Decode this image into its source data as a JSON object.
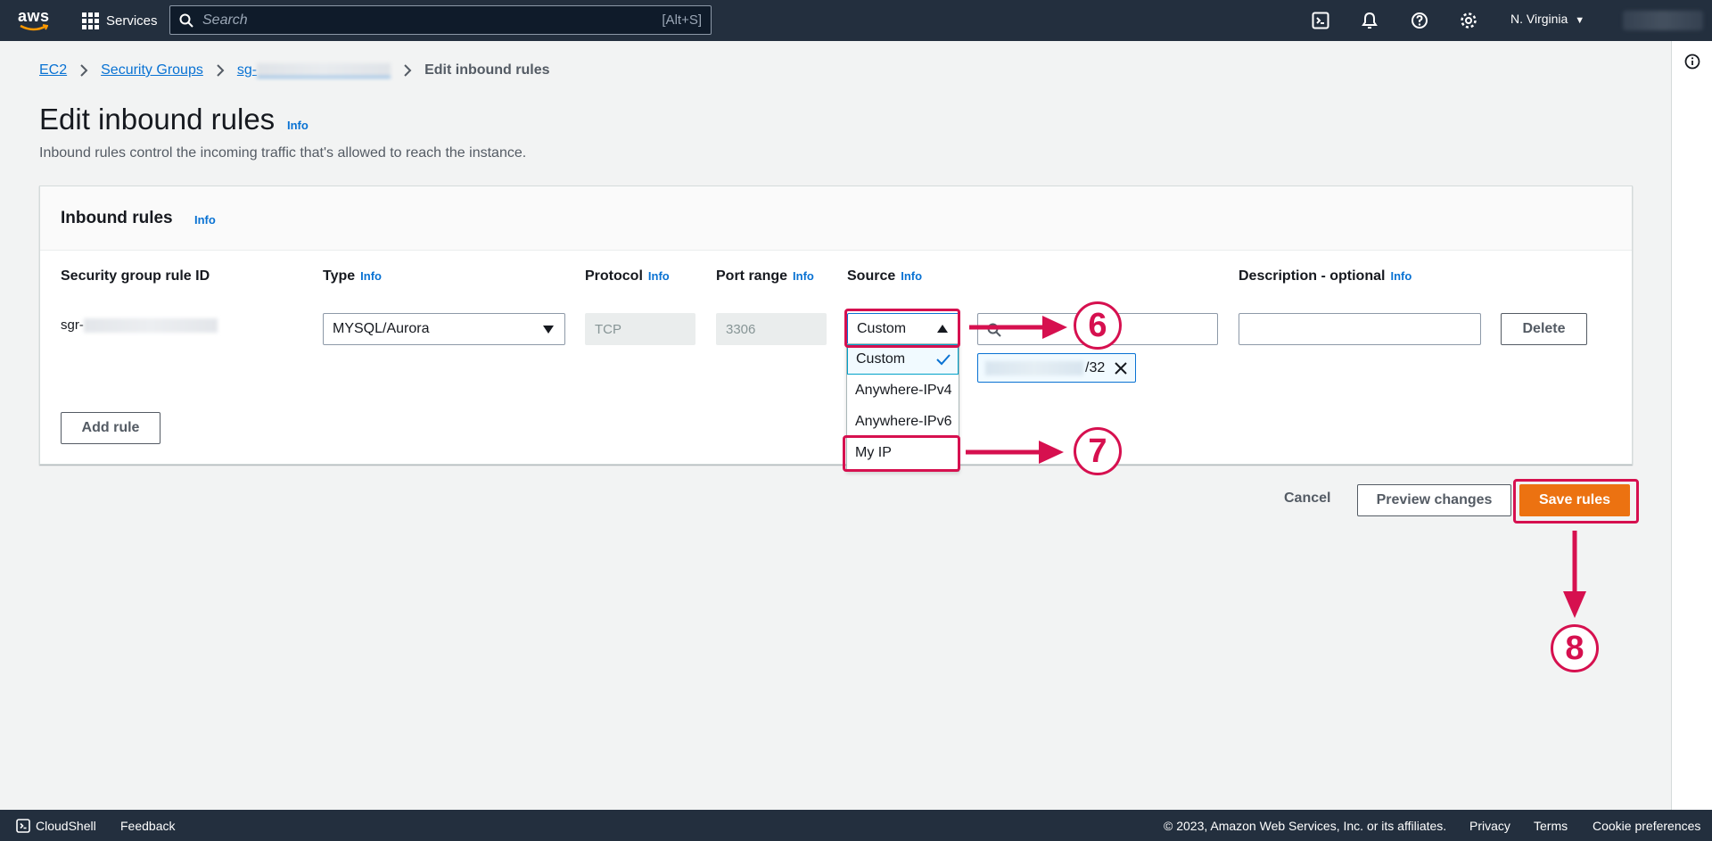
{
  "topnav": {
    "logo_text": "aws",
    "services_label": "Services",
    "search_placeholder": "Search",
    "search_shortcut": "[Alt+S]",
    "region_label": "N. Virginia"
  },
  "breadcrumb": {
    "items": [
      "EC2",
      "Security Groups",
      "sg-"
    ],
    "current": "Edit inbound rules"
  },
  "page": {
    "title": "Edit inbound rules",
    "info": "Info",
    "description": "Inbound rules control the incoming traffic that's allowed to reach the instance."
  },
  "container": {
    "title": "Inbound rules",
    "info": "Info",
    "columns": {
      "rule_id": "Security group rule ID",
      "type": "Type",
      "protocol": "Protocol",
      "port_range": "Port range",
      "source": "Source",
      "description": "Description - optional",
      "info": "Info"
    },
    "row": {
      "rule_id_prefix": "sgr-",
      "type_value": "MYSQL/Aurora",
      "protocol_value": "TCP",
      "port_value": "3306",
      "source_value": "Custom",
      "chip_suffix": "/32",
      "delete_label": "Delete"
    },
    "source_options": [
      "Custom",
      "Anywhere-IPv4",
      "Anywhere-IPv6",
      "My IP"
    ],
    "add_rule_label": "Add rule"
  },
  "actions": {
    "cancel": "Cancel",
    "preview": "Preview changes",
    "save": "Save rules"
  },
  "annotations": {
    "step6": "6",
    "step7": "7",
    "step8": "8",
    "color": "#d6104f"
  },
  "bottombar": {
    "cloudshell": "CloudShell",
    "feedback": "Feedback",
    "copyright": "© 2023, Amazon Web Services, Inc. or its affiliates.",
    "privacy": "Privacy",
    "terms": "Terms",
    "cookies": "Cookie preferences"
  },
  "colors": {
    "nav_bg": "#232f3e",
    "link": "#0972d3",
    "primary": "#ec7211"
  }
}
